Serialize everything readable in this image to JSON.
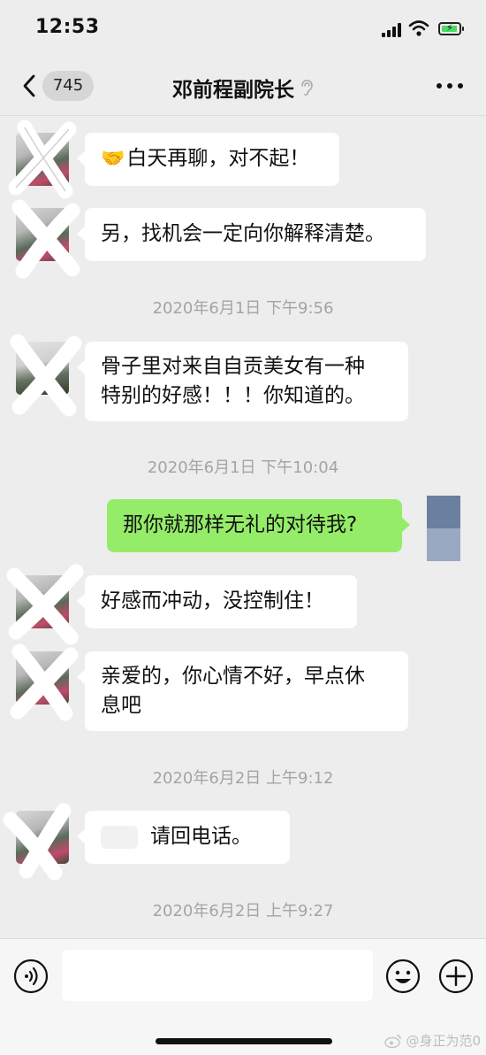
{
  "status_bar": {
    "time": "12:53"
  },
  "nav": {
    "unread_count": "745",
    "title": "邓前程副院长"
  },
  "messages": [
    {
      "side": "left",
      "text": "白天再聊，对不起！",
      "emoji": "🤝"
    },
    {
      "side": "left",
      "text": "另，找机会一定向你解释清楚。"
    },
    {
      "timestamp": "2020年6月1日 下午9:56"
    },
    {
      "side": "left",
      "text_line1": "骨子里对来自自贡美女有一种",
      "text_line2": "特别的好感！！！你知道的。"
    },
    {
      "timestamp": "2020年6月1日 下午10:04"
    },
    {
      "side": "right",
      "text": "那你就那样无礼的对待我?"
    },
    {
      "side": "left",
      "text": "好感而冲动，没控制住！"
    },
    {
      "side": "left",
      "text_line1": "亲爱的，你心情不好，早点休",
      "text_line2": "息吧"
    },
    {
      "timestamp": "2020年6月2日 上午9:12"
    },
    {
      "side": "left",
      "text": "请回电话。"
    },
    {
      "timestamp": "2020年6月2日 上午9:27"
    }
  ],
  "input_bar": {
    "placeholder": ""
  },
  "watermark": {
    "text": "@身正为范0"
  },
  "icons": [
    "back-chevron",
    "mute-ear",
    "more-dots",
    "voice",
    "emoji",
    "plus"
  ],
  "colors": {
    "background": "#ededed",
    "my_bubble": "#95ec69",
    "their_bubble": "#ffffff"
  }
}
